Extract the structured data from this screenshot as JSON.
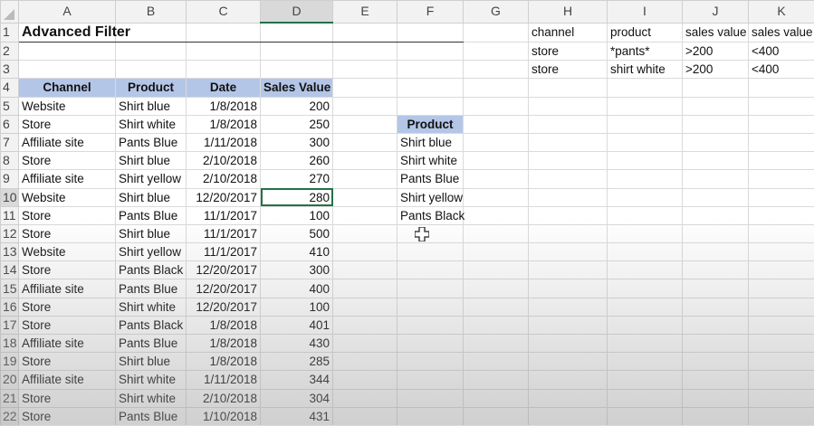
{
  "columns": [
    "A",
    "B",
    "C",
    "D",
    "E",
    "F",
    "G",
    "H",
    "I",
    "J",
    "K"
  ],
  "selected_column": "D",
  "selected_row": 10,
  "active_cell": "D10",
  "rows": [
    [
      "Advanced Filter",
      "",
      "",
      "",
      "",
      "",
      "",
      "channel",
      "product",
      "sales value",
      "sales value"
    ],
    [
      "",
      "",
      "",
      "",
      "",
      "",
      "",
      "store",
      "*pants*",
      ">200",
      "<400"
    ],
    [
      "",
      "",
      "",
      "",
      "",
      "",
      "",
      "store",
      "shirt white",
      ">200",
      "<400"
    ],
    [
      "Channel",
      "Product",
      "Date",
      "Sales Value",
      "",
      "",
      "",
      "",
      "",
      "",
      ""
    ],
    [
      "Website",
      "Shirt blue",
      "1/8/2018",
      "200",
      "",
      "",
      "",
      "",
      "",
      "",
      ""
    ],
    [
      "Store",
      "Shirt white",
      "1/8/2018",
      "250",
      "",
      "Product",
      "",
      "",
      "",
      "",
      ""
    ],
    [
      "Affiliate site",
      "Pants Blue",
      "1/11/2018",
      "300",
      "",
      "Shirt blue",
      "",
      "",
      "",
      "",
      ""
    ],
    [
      "Store",
      "Shirt blue",
      "2/10/2018",
      "260",
      "",
      "Shirt white",
      "",
      "",
      "",
      "",
      ""
    ],
    [
      "Affiliate site",
      "Shirt yellow",
      "2/10/2018",
      "270",
      "",
      "Pants Blue",
      "",
      "",
      "",
      "",
      ""
    ],
    [
      "Website",
      "Shirt blue",
      "12/20/2017",
      "280",
      "",
      "Shirt yellow",
      "",
      "",
      "",
      "",
      ""
    ],
    [
      "Store",
      "Pants Blue",
      "11/1/2017",
      "100",
      "",
      "Pants Black",
      "",
      "",
      "",
      "",
      ""
    ],
    [
      "Store",
      "Shirt blue",
      "11/1/2017",
      "500",
      "",
      "",
      "",
      "",
      "",
      "",
      ""
    ],
    [
      "Website",
      "Shirt yellow",
      "11/1/2017",
      "410",
      "",
      "",
      "",
      "",
      "",
      "",
      ""
    ],
    [
      "Store",
      "Pants Black",
      "12/20/2017",
      "300",
      "",
      "",
      "",
      "",
      "",
      "",
      ""
    ],
    [
      "Affiliate site",
      "Pants Blue",
      "12/20/2017",
      "400",
      "",
      "",
      "",
      "",
      "",
      "",
      ""
    ],
    [
      "Store",
      "Shirt white",
      "12/20/2017",
      "100",
      "",
      "",
      "",
      "",
      "",
      "",
      ""
    ],
    [
      "Store",
      "Pants Black",
      "1/8/2018",
      "401",
      "",
      "",
      "",
      "",
      "",
      "",
      ""
    ],
    [
      "Affiliate site",
      "Pants Blue",
      "1/8/2018",
      "430",
      "",
      "",
      "",
      "",
      "",
      "",
      ""
    ],
    [
      "Store",
      "Shirt blue",
      "1/8/2018",
      "285",
      "",
      "",
      "",
      "",
      "",
      "",
      ""
    ],
    [
      "Affiliate site",
      "Shirt white",
      "1/11/2018",
      "344",
      "",
      "",
      "",
      "",
      "",
      "",
      ""
    ],
    [
      "Store",
      "Shirt white",
      "2/10/2018",
      "304",
      "",
      "",
      "",
      "",
      "",
      "",
      ""
    ],
    [
      "Store",
      "Pants Blue",
      "1/10/2018",
      "431",
      "",
      "",
      "",
      "",
      "",
      "",
      ""
    ]
  ],
  "colors": {
    "header_fill": "#b4c6e7",
    "selection": "#217346"
  }
}
